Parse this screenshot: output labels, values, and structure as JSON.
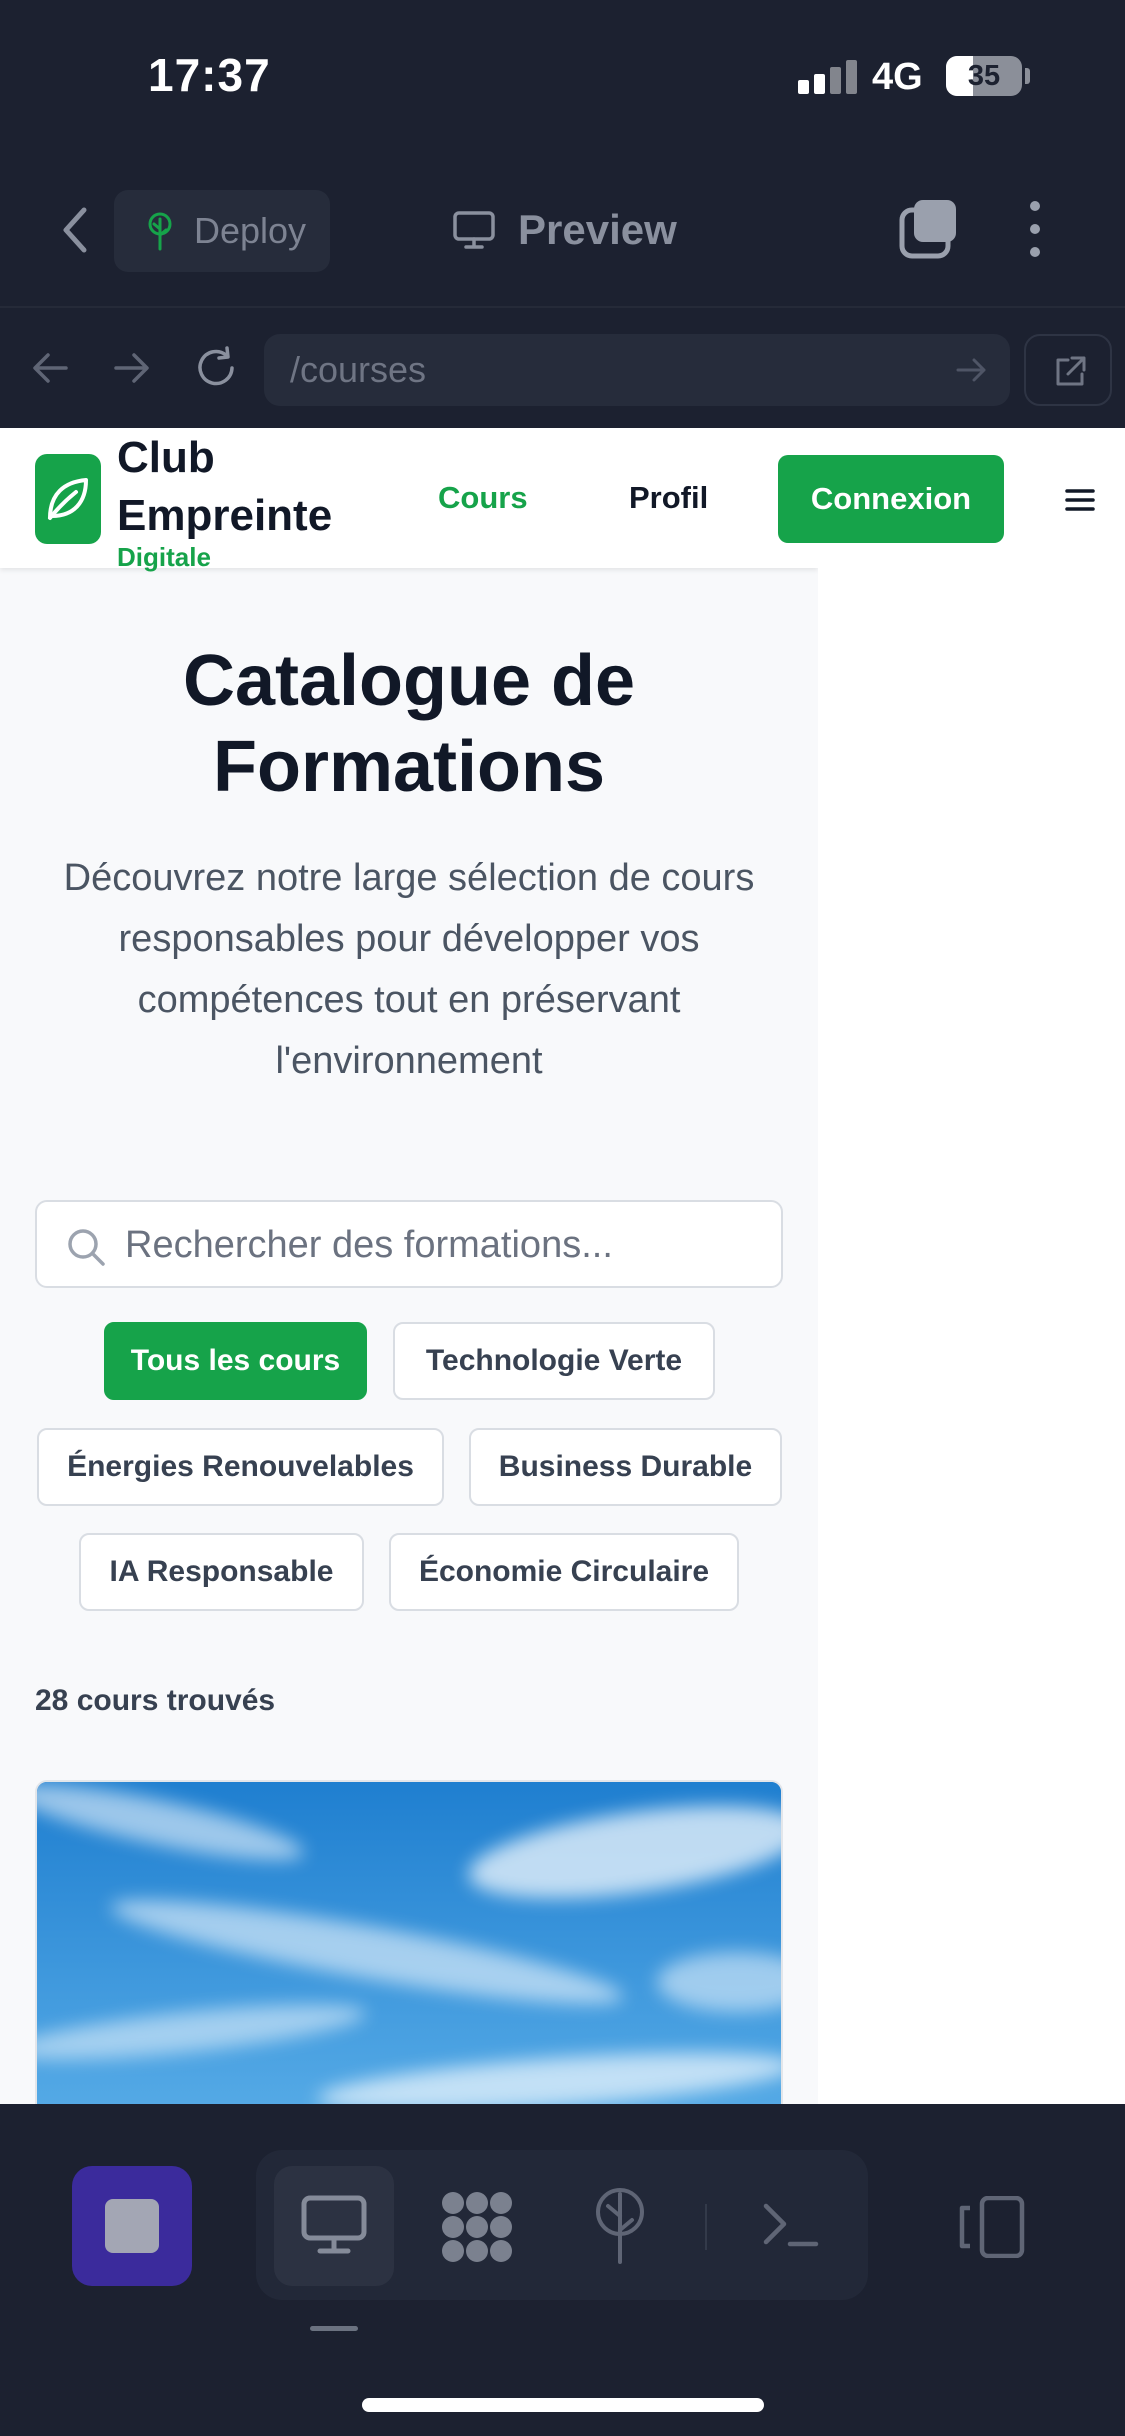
{
  "status_bar": {
    "time": "17:37",
    "network": "4G",
    "battery": "35",
    "battery_level": 0.35
  },
  "app_bar": {
    "deploy_label": "Deploy",
    "preview_label": "Preview"
  },
  "url_bar": {
    "path": "/courses"
  },
  "site": {
    "brand_line1": "Club",
    "brand_line2": "Empreinte",
    "brand_sub": "Digitale",
    "nav": {
      "courses": "Cours",
      "profile": "Profil",
      "login": "Connexion"
    }
  },
  "catalog": {
    "title_line1": "Catalogue de",
    "title_line2": "Formations",
    "description": "Découvrez notre large sélection de cours responsables pour développer vos compétences tout en préservant l'environnement",
    "search_placeholder": "Rechercher des formations...",
    "filters": [
      "Tous les cours",
      "Technologie Verte",
      "Énergies Renouvelables",
      "Business Durable",
      "IA Responsable",
      "Économie Circulaire"
    ],
    "active_filter": "Tous les cours",
    "results_count": "28 cours trouvés"
  },
  "colors": {
    "brand_green": "#16a34a",
    "app_background": "#1c2130",
    "stop_button": "#3b2b9c"
  },
  "icons": {
    "app_bar": [
      "chevron-left-icon",
      "tree-icon",
      "monitor-icon",
      "copy-icon",
      "more-vertical-icon"
    ],
    "url_bar": [
      "arrow-left-icon",
      "arrow-right-icon",
      "reload-icon",
      "arrow-right-icon",
      "external-link-icon"
    ],
    "site": [
      "leaf-icon",
      "menu-icon",
      "search-icon"
    ],
    "toolbar": [
      "stop-icon",
      "monitor-icon",
      "apps-grid-icon",
      "deploy-tree-icon",
      "terminal-icon",
      "device-toggle-icon"
    ]
  }
}
